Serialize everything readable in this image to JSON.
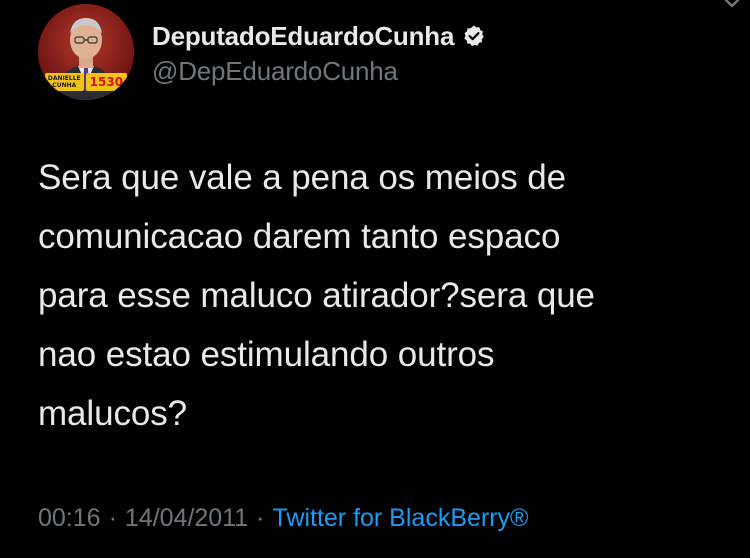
{
  "profile": {
    "display_name": "DeputadoEduardoCunha",
    "handle": "@DepEduardoCunha",
    "verified": true,
    "avatar_badge_left": "DANIELLE\nCUNHA",
    "avatar_badge_right": "1530"
  },
  "tweet": {
    "text": "Sera que vale a pena os meios de\ncomunicacao darem tanto espaco\npara esse maluco atirador?sera que\nnao estao estimulando outros\nmalucos?",
    "time": "00:16",
    "separator": "·",
    "date": "14/04/2011",
    "source": "Twitter for BlackBerry®"
  },
  "icons": {
    "verified": "verified-badge-icon",
    "more": "chevron-down-icon"
  },
  "colors": {
    "background": "#000000",
    "text": "#e7e9ea",
    "secondary": "#71767b",
    "link": "#1d9bf0"
  }
}
